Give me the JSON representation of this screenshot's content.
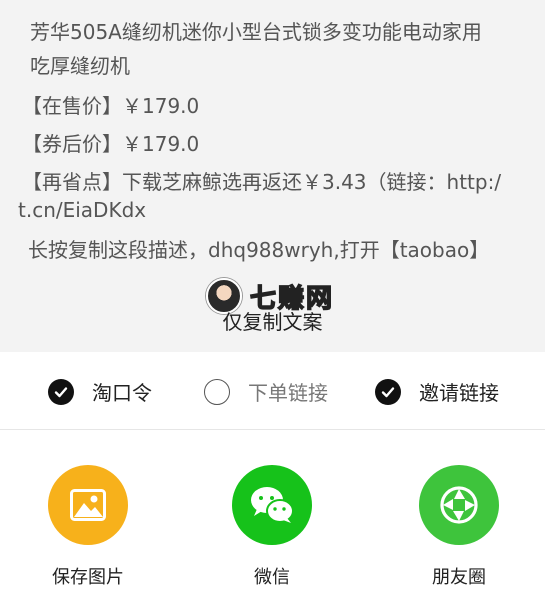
{
  "description": {
    "lines": [
      "芳华505A缝纫机迷你小型台式锁多变功能电动家用",
      "吃厚缝纫机",
      "【在售价】￥179.0",
      "【券后价】￥179.0",
      "【再省点】下载芝麻鲸选再返还￥3.43（链接：http:/",
      "t.cn/EiaDKdx",
      "长按复制这段描述，dhq988wryh,打开【taobao】"
    ]
  },
  "watermark": {
    "text": "七赚网"
  },
  "copy_only_label": "仅复制文案",
  "options": [
    {
      "label": "淘口令",
      "checked": true
    },
    {
      "label": "下单链接",
      "checked": false
    },
    {
      "label": "邀请链接",
      "checked": true
    }
  ],
  "share": [
    {
      "label": "保存图片",
      "color": "#f7b11b",
      "icon": "image-icon"
    },
    {
      "label": "微信",
      "color": "#16c21a",
      "icon": "wechat-icon"
    },
    {
      "label": "朋友圈",
      "color": "#3ec43c",
      "icon": "moments-icon"
    }
  ]
}
